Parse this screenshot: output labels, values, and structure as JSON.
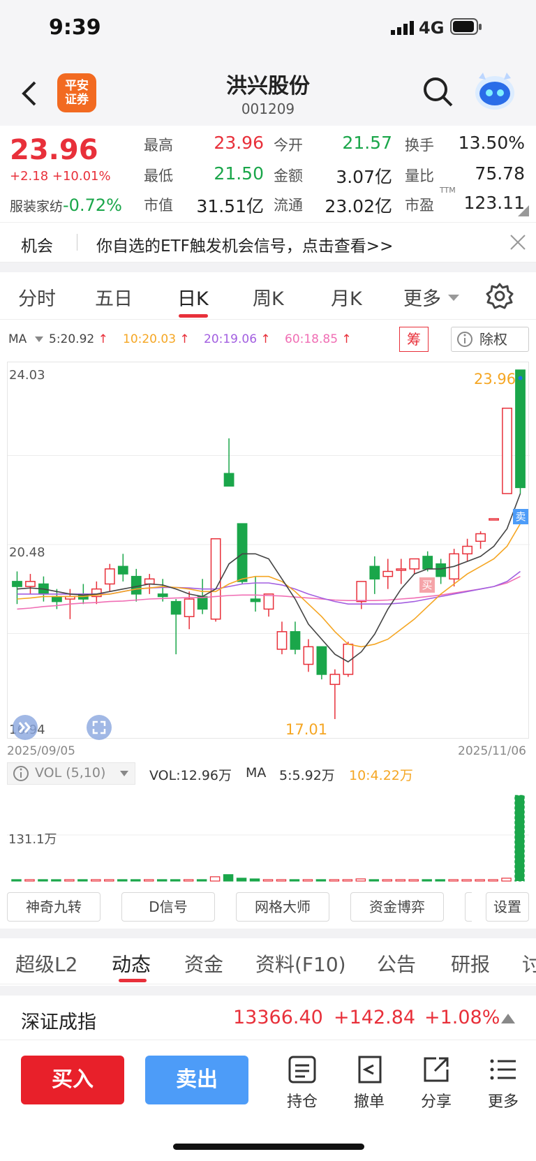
{
  "status_bar": {
    "time": "9:39",
    "network": "4G"
  },
  "header": {
    "logo_line1": "平安",
    "logo_line2": "证券",
    "name": "洪兴股份",
    "code": "001209"
  },
  "quote": {
    "price": "23.96",
    "change": "+2.18 +10.01%",
    "sector_label": "服装家纺",
    "sector_change": "-0.72%",
    "fields": [
      {
        "label": "最高",
        "value": "23.96"
      },
      {
        "label": "今开",
        "value": "21.57"
      },
      {
        "label": "换手",
        "value": "13.50%"
      },
      {
        "label": "最低",
        "value": "21.50"
      },
      {
        "label": "金额",
        "value": "3.07亿"
      },
      {
        "label": "量比",
        "value": "75.78"
      },
      {
        "label": "市值",
        "value": "31.51亿"
      },
      {
        "label": "流通",
        "value": "23.02亿"
      },
      {
        "label": "市盈",
        "value": "123.11",
        "sup": "TTM"
      }
    ]
  },
  "notice": {
    "tag": "机会",
    "text": "你自选的ETF触发机会信号，点击查看>>"
  },
  "period_tabs": [
    "分时",
    "五日",
    "日K",
    "周K",
    "月K",
    "更多"
  ],
  "active_period": "日K",
  "ma": {
    "label": "MA",
    "items": [
      {
        "text": "5:20.92",
        "color": "#444444"
      },
      {
        "text": "10:20.03",
        "color": "#f5a623"
      },
      {
        "text": "20:19.06",
        "color": "#a25ee0"
      },
      {
        "text": "60:18.85",
        "color": "#f06eb4"
      }
    ],
    "chip_button": "筹",
    "adjust_button": "除权"
  },
  "chart_data": {
    "type": "candlestick",
    "y_top_label": "24.03",
    "y_mid_label": "20.48",
    "y_bottom_label": "16.94",
    "ylim": [
      16.94,
      24.03
    ],
    "x_start": "2025/09/05",
    "x_end": "2025/11/06",
    "max_label": "23.96",
    "min_label": "17.01",
    "buy_marker": "买",
    "sell_marker": "卖",
    "candles": [
      {
        "o": 19.75,
        "c": 19.65,
        "h": 19.95,
        "l": 19.3
      },
      {
        "o": 19.65,
        "c": 19.75,
        "h": 19.9,
        "l": 19.5
      },
      {
        "o": 19.7,
        "c": 19.5,
        "h": 19.85,
        "l": 19.35
      },
      {
        "o": 19.45,
        "c": 19.35,
        "h": 19.6,
        "l": 19.2
      },
      {
        "o": 19.4,
        "c": 19.45,
        "h": 19.6,
        "l": 19.0
      },
      {
        "o": 19.5,
        "c": 19.4,
        "h": 19.7,
        "l": 19.3
      },
      {
        "o": 19.45,
        "c": 19.6,
        "h": 19.75,
        "l": 19.3
      },
      {
        "o": 19.7,
        "c": 20.0,
        "h": 20.1,
        "l": 19.55
      },
      {
        "o": 20.05,
        "c": 19.9,
        "h": 20.3,
        "l": 19.75
      },
      {
        "o": 19.85,
        "c": 19.5,
        "h": 20.0,
        "l": 19.35
      },
      {
        "o": 19.7,
        "c": 19.8,
        "h": 19.9,
        "l": 19.5
      },
      {
        "o": 19.5,
        "c": 19.45,
        "h": 19.8,
        "l": 19.35
      },
      {
        "o": 19.35,
        "c": 19.1,
        "h": 19.4,
        "l": 18.3
      },
      {
        "o": 19.05,
        "c": 19.4,
        "h": 19.55,
        "l": 18.8
      },
      {
        "o": 19.45,
        "c": 19.2,
        "h": 19.8,
        "l": 19.1
      },
      {
        "o": 19.0,
        "c": 20.6,
        "h": 20.6,
        "l": 18.95
      },
      {
        "o": 21.9,
        "c": 21.65,
        "h": 22.6,
        "l": 21.65
      },
      {
        "o": 20.9,
        "c": 19.75,
        "h": 20.9,
        "l": 19.7
      },
      {
        "o": 19.4,
        "c": 19.35,
        "h": 19.85,
        "l": 19.15
      },
      {
        "o": 19.2,
        "c": 19.5,
        "h": 19.5,
        "l": 19.05
      },
      {
        "o": 18.4,
        "c": 18.75,
        "h": 18.95,
        "l": 18.3
      },
      {
        "o": 18.75,
        "c": 18.4,
        "h": 18.95,
        "l": 18.3
      },
      {
        "o": 18.1,
        "c": 18.45,
        "h": 18.6,
        "l": 17.95
      },
      {
        "o": 18.45,
        "c": 17.9,
        "h": 18.45,
        "l": 17.8
      },
      {
        "o": 17.7,
        "c": 17.9,
        "h": 18.0,
        "l": 17.01
      },
      {
        "o": 17.9,
        "c": 18.5,
        "h": 18.55,
        "l": 17.85
      },
      {
        "o": 19.35,
        "c": 19.75,
        "h": 19.75,
        "l": 19.2
      },
      {
        "o": 20.05,
        "c": 19.8,
        "h": 20.25,
        "l": 19.5
      },
      {
        "o": 19.85,
        "c": 19.95,
        "h": 20.2,
        "l": 19.6
      },
      {
        "o": 20.0,
        "c": 20.0,
        "h": 20.2,
        "l": 19.7
      },
      {
        "o": 20.0,
        "c": 20.2,
        "h": 20.2,
        "l": 19.9
      },
      {
        "o": 20.25,
        "c": 20.0,
        "h": 20.35,
        "l": 19.95
      },
      {
        "o": 20.1,
        "c": 19.85,
        "h": 20.2,
        "l": 19.7
      },
      {
        "o": 19.8,
        "c": 20.3,
        "h": 20.4,
        "l": 19.65
      },
      {
        "o": 20.3,
        "c": 20.45,
        "h": 20.6,
        "l": 20.15
      },
      {
        "o": 20.55,
        "c": 20.7,
        "h": 20.75,
        "l": 20.4
      },
      {
        "o": 21.0,
        "c": 21.0,
        "h": 21.0,
        "l": 21.0
      },
      {
        "o": 21.5,
        "c": 23.2,
        "h": 23.2,
        "l": 21.5
      },
      {
        "o": 23.96,
        "c": 21.62,
        "h": 23.96,
        "l": 21.5
      }
    ],
    "ma5": [
      19.6,
      19.62,
      19.6,
      19.55,
      19.5,
      19.48,
      19.5,
      19.55,
      19.6,
      19.65,
      19.7,
      19.68,
      19.6,
      19.5,
      19.45,
      19.6,
      20.1,
      20.3,
      20.3,
      20.2,
      19.8,
      19.4,
      18.9,
      18.6,
      18.3,
      18.15,
      18.35,
      18.7,
      19.2,
      19.6,
      19.9,
      20.0,
      20.0,
      20.05,
      20.15,
      20.25,
      20.45,
      20.8,
      21.5
    ],
    "ma10": [
      19.4,
      19.42,
      19.45,
      19.45,
      19.45,
      19.45,
      19.48,
      19.5,
      19.55,
      19.6,
      19.62,
      19.65,
      19.63,
      19.6,
      19.55,
      19.55,
      19.7,
      19.8,
      19.85,
      19.85,
      19.75,
      19.55,
      19.3,
      19.05,
      18.75,
      18.5,
      18.45,
      18.5,
      18.6,
      18.8,
      19.0,
      19.25,
      19.5,
      19.7,
      19.9,
      20.05,
      20.2,
      20.45,
      20.9
    ],
    "ma20": [
      19.5,
      19.5,
      19.5,
      19.5,
      19.5,
      19.5,
      19.5,
      19.5,
      19.55,
      19.6,
      19.62,
      19.63,
      19.63,
      19.62,
      19.6,
      19.6,
      19.65,
      19.7,
      19.72,
      19.72,
      19.68,
      19.6,
      19.5,
      19.42,
      19.35,
      19.3,
      19.3,
      19.3,
      19.3,
      19.32,
      19.35,
      19.4,
      19.45,
      19.5,
      19.55,
      19.6,
      19.65,
      19.75,
      19.95
    ],
    "ma60": [
      19.2,
      19.22,
      19.25,
      19.27,
      19.3,
      19.32,
      19.33,
      19.35,
      19.36,
      19.38,
      19.4,
      19.41,
      19.42,
      19.43,
      19.43,
      19.45,
      19.47,
      19.48,
      19.48,
      19.47,
      19.46,
      19.44,
      19.42,
      19.4,
      19.38,
      19.37,
      19.37,
      19.37,
      19.38,
      19.4,
      19.42,
      19.45,
      19.48,
      19.52,
      19.56,
      19.6,
      19.65,
      19.72,
      19.85
    ],
    "volumes": [
      2,
      2,
      2,
      1,
      2,
      2,
      2,
      2,
      2,
      2,
      2,
      2,
      2,
      2,
      2,
      6,
      9,
      4,
      3,
      2,
      2,
      2,
      2,
      2,
      2,
      2,
      3,
      2,
      2,
      2,
      2,
      2,
      2,
      2,
      2,
      2,
      2,
      4,
      120
    ],
    "vol_label": "131.1万",
    "vol_max": 131.1
  },
  "volume_bar": {
    "indicator": "VOL (5,10)",
    "vol": "VOL:12.96万",
    "ma_label": "MA",
    "ma5": "5:5.92万",
    "ma10": "10:4.22万"
  },
  "tools": [
    "神奇九转",
    "D信号",
    "网格大师",
    "资金博弈",
    "设置"
  ],
  "content_tabs": [
    "超级L2",
    "动态",
    "资金",
    "资料(F10)",
    "公告",
    "研报",
    "讨"
  ],
  "active_content_tab": "动态",
  "index": {
    "name": "深证成指",
    "value": "13366.40",
    "change": "+142.84",
    "pct": "+1.08%"
  },
  "bottom": {
    "buy": "买入",
    "sell": "卖出",
    "actions": [
      {
        "icon": "holdings-icon",
        "label": "持仓"
      },
      {
        "icon": "cancel-order-icon",
        "label": "撤单"
      },
      {
        "icon": "share-icon",
        "label": "分享"
      },
      {
        "icon": "more-icon",
        "label": "更多"
      }
    ]
  },
  "colors": {
    "up": "#e8303a",
    "down": "#1aa64a",
    "accent_orange": "#f26a21",
    "sell_blue": "#4d9cf8"
  }
}
